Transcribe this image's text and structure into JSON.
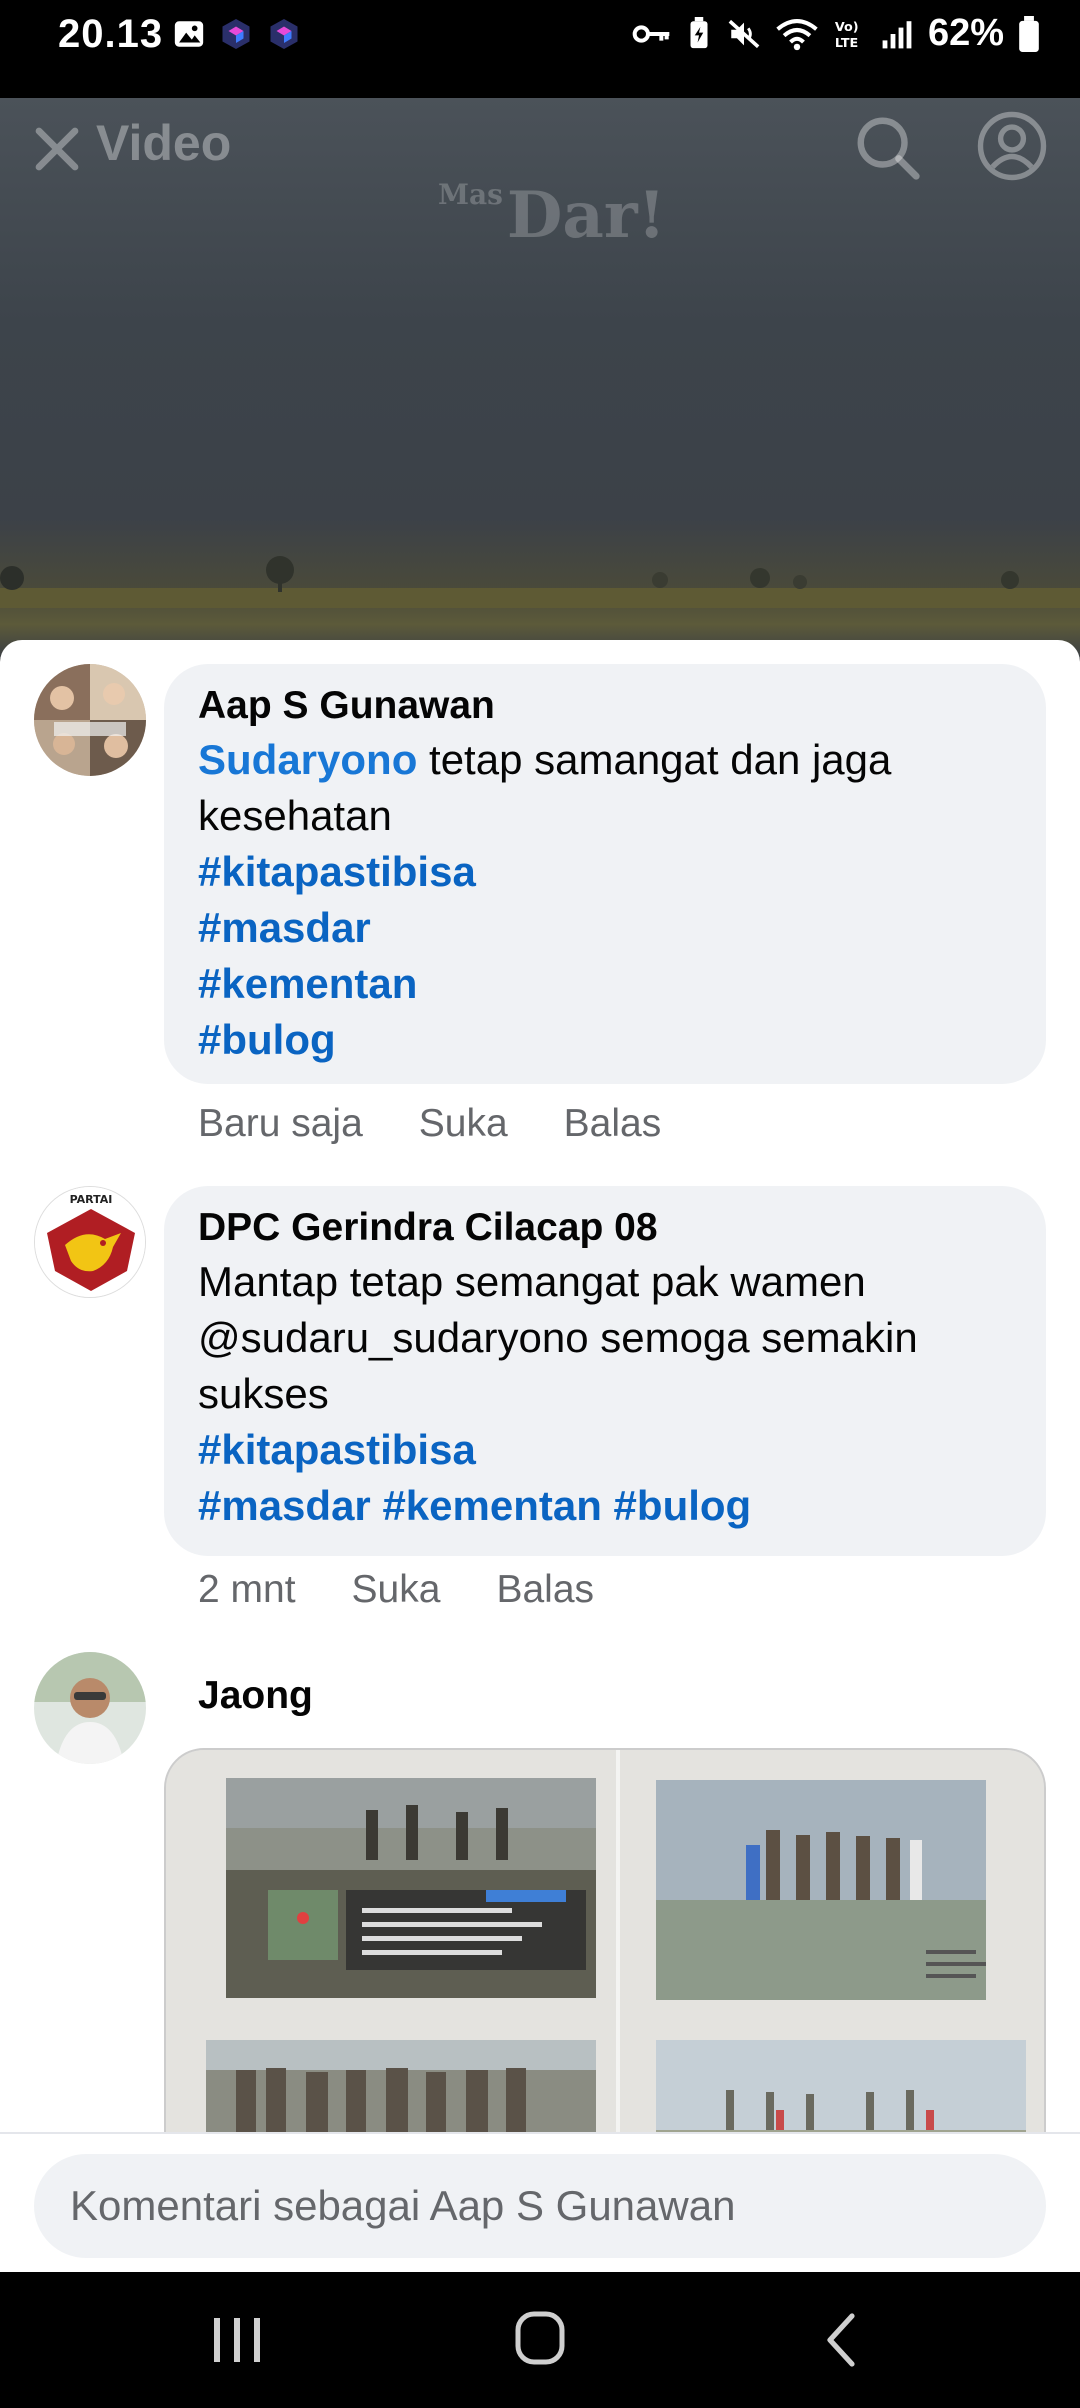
{
  "status_bar": {
    "time": "20.13",
    "battery": "62%",
    "icons": [
      "gallery-icon",
      "app-icon",
      "app-icon",
      "key-icon",
      "battery-saver-icon",
      "mute-icon",
      "wifi-icon",
      "volte-icon",
      "signal-icon",
      "battery-icon"
    ]
  },
  "video": {
    "title": "Video",
    "watermark_small": "Mas",
    "watermark": "Dar!"
  },
  "comments": [
    {
      "author": "Aap S Gunawan",
      "mention": "Sudaryono",
      "text": " tetap samangat dan jaga kesehatan",
      "tags": [
        "#kitapastibisa",
        "#masdar",
        "#kementan",
        "#bulog"
      ],
      "time": "Baru saja",
      "like": "Suka",
      "reply": "Balas"
    },
    {
      "author": "DPC Gerindra Cilacap 08",
      "avatar_text": "PARTAI",
      "text": "Mantap tetap semangat pak wamen @sudaru_sudaryono semoga semakin sukses",
      "tags_line1": "#kitapastibisa",
      "tags_line2": "#masdar #kementan #bulog",
      "time": "2 mnt",
      "like": "Suka",
      "reply": "Balas"
    },
    {
      "author": "Jaong"
    }
  ],
  "composer": {
    "placeholder": "Komentari sebagai Aap S Gunawan"
  }
}
